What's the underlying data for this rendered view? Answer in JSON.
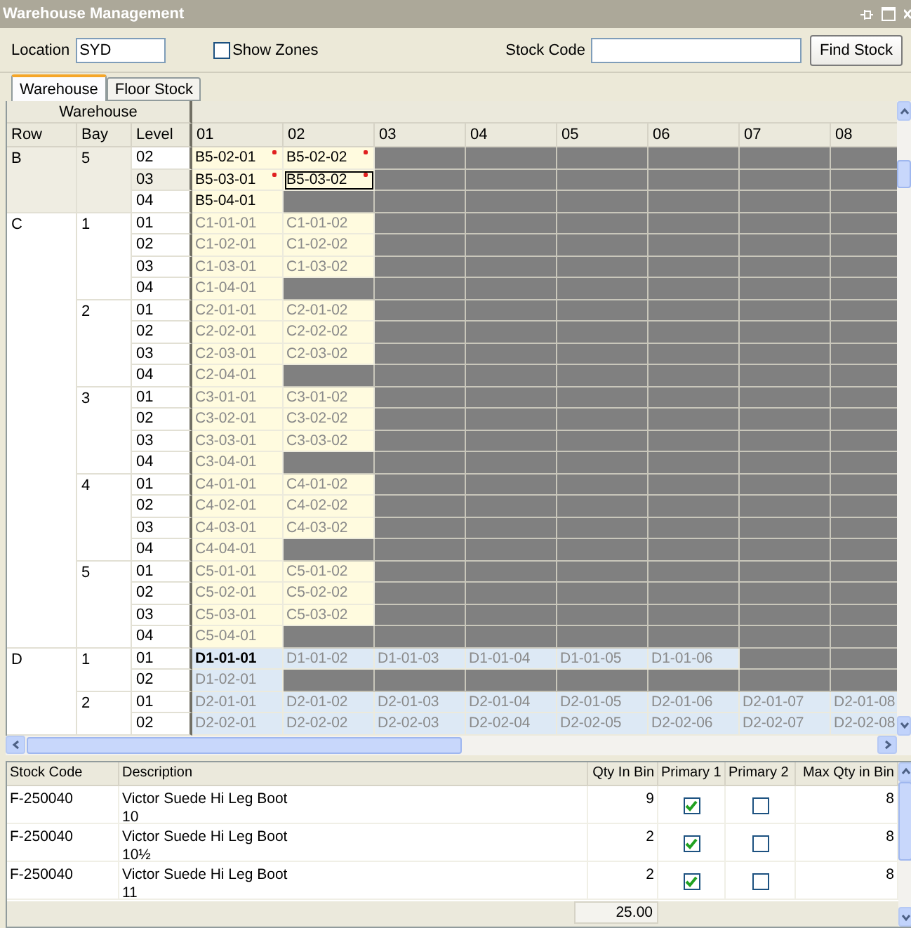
{
  "window": {
    "title": "Warehouse Management"
  },
  "toolbar": {
    "location_label": "Location",
    "location_value": "SYD",
    "show_zones": {
      "label": "Show Zones",
      "checked": false
    },
    "stock_code_label": "Stock Code",
    "find_button": "Find Stock"
  },
  "tabs": [
    {
      "label": "Warehouse",
      "selected": true
    },
    {
      "label": "Floor Stock",
      "selected": false
    }
  ],
  "grid": {
    "group_header": "Warehouse",
    "columns": [
      "Row",
      "Bay",
      "Level"
    ],
    "bin_columns": [
      "01",
      "02",
      "03",
      "04",
      "05",
      "06",
      "07",
      "08"
    ],
    "rows": [
      {
        "row": "B",
        "selected": true,
        "color": "#fffbdf",
        "bays": [
          {
            "bay": "5",
            "levels": [
              {
                "level": "02",
                "selected": false,
                "cells": [
                  {
                    "label": "B5-02-01",
                    "kind": "flagged"
                  },
                  {
                    "label": "B5-02-02",
                    "kind": "flagged"
                  },
                  {
                    "kind": "none"
                  },
                  {
                    "kind": "none"
                  },
                  {
                    "kind": "none"
                  },
                  {
                    "kind": "none"
                  },
                  {
                    "kind": "none"
                  },
                  {
                    "kind": "none"
                  }
                ]
              },
              {
                "level": "03",
                "selected": true,
                "cells": [
                  {
                    "label": "B5-03-01",
                    "kind": "flagged"
                  },
                  {
                    "label": "B5-03-02",
                    "kind": "focused"
                  },
                  {
                    "kind": "none"
                  },
                  {
                    "kind": "none"
                  },
                  {
                    "kind": "none"
                  },
                  {
                    "kind": "none"
                  },
                  {
                    "kind": "none"
                  },
                  {
                    "kind": "none"
                  }
                ]
              },
              {
                "level": "04",
                "selected": false,
                "cells": [
                  {
                    "label": "B5-04-01",
                    "kind": "stocked"
                  },
                  {
                    "kind": "none"
                  },
                  {
                    "kind": "none"
                  },
                  {
                    "kind": "none"
                  },
                  {
                    "kind": "none"
                  },
                  {
                    "kind": "none"
                  },
                  {
                    "kind": "none"
                  },
                  {
                    "kind": "none"
                  }
                ]
              }
            ]
          }
        ]
      },
      {
        "row": "C",
        "selected": false,
        "color": "#fffbdf",
        "bays": [
          {
            "bay": "1",
            "levels": [
              {
                "level": "01",
                "selected": false,
                "cells": [
                  {
                    "label": "C1-01-01",
                    "kind": "bin"
                  },
                  {
                    "label": "C1-01-02",
                    "kind": "bin"
                  },
                  {
                    "kind": "none"
                  },
                  {
                    "kind": "none"
                  },
                  {
                    "kind": "none"
                  },
                  {
                    "kind": "none"
                  },
                  {
                    "kind": "none"
                  },
                  {
                    "kind": "none"
                  }
                ]
              },
              {
                "level": "02",
                "selected": false,
                "cells": [
                  {
                    "label": "C1-02-01",
                    "kind": "bin"
                  },
                  {
                    "label": "C1-02-02",
                    "kind": "bin"
                  },
                  {
                    "kind": "none"
                  },
                  {
                    "kind": "none"
                  },
                  {
                    "kind": "none"
                  },
                  {
                    "kind": "none"
                  },
                  {
                    "kind": "none"
                  },
                  {
                    "kind": "none"
                  }
                ]
              },
              {
                "level": "03",
                "selected": false,
                "cells": [
                  {
                    "label": "C1-03-01",
                    "kind": "bin"
                  },
                  {
                    "label": "C1-03-02",
                    "kind": "bin"
                  },
                  {
                    "kind": "none"
                  },
                  {
                    "kind": "none"
                  },
                  {
                    "kind": "none"
                  },
                  {
                    "kind": "none"
                  },
                  {
                    "kind": "none"
                  },
                  {
                    "kind": "none"
                  }
                ]
              },
              {
                "level": "04",
                "selected": false,
                "cells": [
                  {
                    "label": "C1-04-01",
                    "kind": "bin"
                  },
                  {
                    "kind": "none"
                  },
                  {
                    "kind": "none"
                  },
                  {
                    "kind": "none"
                  },
                  {
                    "kind": "none"
                  },
                  {
                    "kind": "none"
                  },
                  {
                    "kind": "none"
                  },
                  {
                    "kind": "none"
                  }
                ]
              }
            ]
          },
          {
            "bay": "2",
            "levels": [
              {
                "level": "01",
                "selected": false,
                "cells": [
                  {
                    "label": "C2-01-01",
                    "kind": "bin"
                  },
                  {
                    "label": "C2-01-02",
                    "kind": "bin"
                  },
                  {
                    "kind": "none"
                  },
                  {
                    "kind": "none"
                  },
                  {
                    "kind": "none"
                  },
                  {
                    "kind": "none"
                  },
                  {
                    "kind": "none"
                  },
                  {
                    "kind": "none"
                  }
                ]
              },
              {
                "level": "02",
                "selected": false,
                "cells": [
                  {
                    "label": "C2-02-01",
                    "kind": "bin"
                  },
                  {
                    "label": "C2-02-02",
                    "kind": "bin"
                  },
                  {
                    "kind": "none"
                  },
                  {
                    "kind": "none"
                  },
                  {
                    "kind": "none"
                  },
                  {
                    "kind": "none"
                  },
                  {
                    "kind": "none"
                  },
                  {
                    "kind": "none"
                  }
                ]
              },
              {
                "level": "03",
                "selected": false,
                "cells": [
                  {
                    "label": "C2-03-01",
                    "kind": "bin"
                  },
                  {
                    "label": "C2-03-02",
                    "kind": "bin"
                  },
                  {
                    "kind": "none"
                  },
                  {
                    "kind": "none"
                  },
                  {
                    "kind": "none"
                  },
                  {
                    "kind": "none"
                  },
                  {
                    "kind": "none"
                  },
                  {
                    "kind": "none"
                  }
                ]
              },
              {
                "level": "04",
                "selected": false,
                "cells": [
                  {
                    "label": "C2-04-01",
                    "kind": "bin"
                  },
                  {
                    "kind": "none"
                  },
                  {
                    "kind": "none"
                  },
                  {
                    "kind": "none"
                  },
                  {
                    "kind": "none"
                  },
                  {
                    "kind": "none"
                  },
                  {
                    "kind": "none"
                  },
                  {
                    "kind": "none"
                  }
                ]
              }
            ]
          },
          {
            "bay": "3",
            "levels": [
              {
                "level": "01",
                "selected": false,
                "cells": [
                  {
                    "label": "C3-01-01",
                    "kind": "bin"
                  },
                  {
                    "label": "C3-01-02",
                    "kind": "bin"
                  },
                  {
                    "kind": "none"
                  },
                  {
                    "kind": "none"
                  },
                  {
                    "kind": "none"
                  },
                  {
                    "kind": "none"
                  },
                  {
                    "kind": "none"
                  },
                  {
                    "kind": "none"
                  }
                ]
              },
              {
                "level": "02",
                "selected": false,
                "cells": [
                  {
                    "label": "C3-02-01",
                    "kind": "bin"
                  },
                  {
                    "label": "C3-02-02",
                    "kind": "bin"
                  },
                  {
                    "kind": "none"
                  },
                  {
                    "kind": "none"
                  },
                  {
                    "kind": "none"
                  },
                  {
                    "kind": "none"
                  },
                  {
                    "kind": "none"
                  },
                  {
                    "kind": "none"
                  }
                ]
              },
              {
                "level": "03",
                "selected": false,
                "cells": [
                  {
                    "label": "C3-03-01",
                    "kind": "bin"
                  },
                  {
                    "label": "C3-03-02",
                    "kind": "bin"
                  },
                  {
                    "kind": "none"
                  },
                  {
                    "kind": "none"
                  },
                  {
                    "kind": "none"
                  },
                  {
                    "kind": "none"
                  },
                  {
                    "kind": "none"
                  },
                  {
                    "kind": "none"
                  }
                ]
              },
              {
                "level": "04",
                "selected": false,
                "cells": [
                  {
                    "label": "C3-04-01",
                    "kind": "bin"
                  },
                  {
                    "kind": "none"
                  },
                  {
                    "kind": "none"
                  },
                  {
                    "kind": "none"
                  },
                  {
                    "kind": "none"
                  },
                  {
                    "kind": "none"
                  },
                  {
                    "kind": "none"
                  },
                  {
                    "kind": "none"
                  }
                ]
              }
            ]
          },
          {
            "bay": "4",
            "levels": [
              {
                "level": "01",
                "selected": false,
                "cells": [
                  {
                    "label": "C4-01-01",
                    "kind": "bin"
                  },
                  {
                    "label": "C4-01-02",
                    "kind": "bin"
                  },
                  {
                    "kind": "none"
                  },
                  {
                    "kind": "none"
                  },
                  {
                    "kind": "none"
                  },
                  {
                    "kind": "none"
                  },
                  {
                    "kind": "none"
                  },
                  {
                    "kind": "none"
                  }
                ]
              },
              {
                "level": "02",
                "selected": false,
                "cells": [
                  {
                    "label": "C4-02-01",
                    "kind": "bin"
                  },
                  {
                    "label": "C4-02-02",
                    "kind": "bin"
                  },
                  {
                    "kind": "none"
                  },
                  {
                    "kind": "none"
                  },
                  {
                    "kind": "none"
                  },
                  {
                    "kind": "none"
                  },
                  {
                    "kind": "none"
                  },
                  {
                    "kind": "none"
                  }
                ]
              },
              {
                "level": "03",
                "selected": false,
                "cells": [
                  {
                    "label": "C4-03-01",
                    "kind": "bin"
                  },
                  {
                    "label": "C4-03-02",
                    "kind": "bin"
                  },
                  {
                    "kind": "none"
                  },
                  {
                    "kind": "none"
                  },
                  {
                    "kind": "none"
                  },
                  {
                    "kind": "none"
                  },
                  {
                    "kind": "none"
                  },
                  {
                    "kind": "none"
                  }
                ]
              },
              {
                "level": "04",
                "selected": false,
                "cells": [
                  {
                    "label": "C4-04-01",
                    "kind": "bin"
                  },
                  {
                    "kind": "none"
                  },
                  {
                    "kind": "none"
                  },
                  {
                    "kind": "none"
                  },
                  {
                    "kind": "none"
                  },
                  {
                    "kind": "none"
                  },
                  {
                    "kind": "none"
                  },
                  {
                    "kind": "none"
                  }
                ]
              }
            ]
          },
          {
            "bay": "5",
            "levels": [
              {
                "level": "01",
                "selected": false,
                "cells": [
                  {
                    "label": "C5-01-01",
                    "kind": "bin"
                  },
                  {
                    "label": "C5-01-02",
                    "kind": "bin"
                  },
                  {
                    "kind": "none"
                  },
                  {
                    "kind": "none"
                  },
                  {
                    "kind": "none"
                  },
                  {
                    "kind": "none"
                  },
                  {
                    "kind": "none"
                  },
                  {
                    "kind": "none"
                  }
                ]
              },
              {
                "level": "02",
                "selected": false,
                "cells": [
                  {
                    "label": "C5-02-01",
                    "kind": "bin"
                  },
                  {
                    "label": "C5-02-02",
                    "kind": "bin"
                  },
                  {
                    "kind": "none"
                  },
                  {
                    "kind": "none"
                  },
                  {
                    "kind": "none"
                  },
                  {
                    "kind": "none"
                  },
                  {
                    "kind": "none"
                  },
                  {
                    "kind": "none"
                  }
                ]
              },
              {
                "level": "03",
                "selected": false,
                "cells": [
                  {
                    "label": "C5-03-01",
                    "kind": "bin"
                  },
                  {
                    "label": "C5-03-02",
                    "kind": "bin"
                  },
                  {
                    "kind": "none"
                  },
                  {
                    "kind": "none"
                  },
                  {
                    "kind": "none"
                  },
                  {
                    "kind": "none"
                  },
                  {
                    "kind": "none"
                  },
                  {
                    "kind": "none"
                  }
                ]
              },
              {
                "level": "04",
                "selected": false,
                "cells": [
                  {
                    "label": "C5-04-01",
                    "kind": "bin"
                  },
                  {
                    "kind": "none"
                  },
                  {
                    "kind": "none"
                  },
                  {
                    "kind": "none"
                  },
                  {
                    "kind": "none"
                  },
                  {
                    "kind": "none"
                  },
                  {
                    "kind": "none"
                  },
                  {
                    "kind": "none"
                  }
                ]
              }
            ]
          }
        ]
      },
      {
        "row": "D",
        "selected": false,
        "color": "#dde9f5",
        "bays": [
          {
            "bay": "1",
            "levels": [
              {
                "level": "01",
                "selected": false,
                "cells": [
                  {
                    "label": "D1-01-01",
                    "kind": "current"
                  },
                  {
                    "label": "D1-01-02",
                    "kind": "bin"
                  },
                  {
                    "label": "D1-01-03",
                    "kind": "bin"
                  },
                  {
                    "label": "D1-01-04",
                    "kind": "bin"
                  },
                  {
                    "label": "D1-01-05",
                    "kind": "bin"
                  },
                  {
                    "label": "D1-01-06",
                    "kind": "bin"
                  },
                  {
                    "kind": "none"
                  },
                  {
                    "kind": "none"
                  }
                ]
              },
              {
                "level": "02",
                "selected": false,
                "cells": [
                  {
                    "label": "D1-02-01",
                    "kind": "bin"
                  },
                  {
                    "kind": "none"
                  },
                  {
                    "kind": "none"
                  },
                  {
                    "kind": "none"
                  },
                  {
                    "kind": "none"
                  },
                  {
                    "kind": "none"
                  },
                  {
                    "kind": "none"
                  },
                  {
                    "kind": "none"
                  }
                ]
              }
            ]
          },
          {
            "bay": "2",
            "levels": [
              {
                "level": "01",
                "selected": false,
                "cells": [
                  {
                    "label": "D2-01-01",
                    "kind": "bin"
                  },
                  {
                    "label": "D2-01-02",
                    "kind": "bin"
                  },
                  {
                    "label": "D2-01-03",
                    "kind": "bin"
                  },
                  {
                    "label": "D2-01-04",
                    "kind": "bin"
                  },
                  {
                    "label": "D2-01-05",
                    "kind": "bin"
                  },
                  {
                    "label": "D2-01-06",
                    "kind": "bin"
                  },
                  {
                    "label": "D2-01-07",
                    "kind": "bin"
                  },
                  {
                    "label": "D2-01-08",
                    "kind": "bin"
                  }
                ]
              },
              {
                "level": "02",
                "selected": false,
                "cells": [
                  {
                    "label": "D2-02-01",
                    "kind": "bin"
                  },
                  {
                    "label": "D2-02-02",
                    "kind": "bin"
                  },
                  {
                    "label": "D2-02-03",
                    "kind": "bin"
                  },
                  {
                    "label": "D2-02-04",
                    "kind": "bin"
                  },
                  {
                    "label": "D2-02-05",
                    "kind": "bin"
                  },
                  {
                    "label": "D2-02-06",
                    "kind": "bin"
                  },
                  {
                    "label": "D2-02-07",
                    "kind": "bin"
                  },
                  {
                    "label": "D2-02-08",
                    "kind": "bin"
                  }
                ]
              }
            ]
          }
        ]
      }
    ]
  },
  "stock_table": {
    "columns": [
      "Stock Code",
      "Description",
      "Qty In Bin",
      "Primary 1",
      "Primary 2",
      "Max Qty in Bin"
    ],
    "rows": [
      {
        "stock_code": "F-250040",
        "description": "Victor Suede Hi Leg Boot\n10",
        "qty_in_bin": "9",
        "primary_1": true,
        "primary_2": false,
        "max_qty": "8"
      },
      {
        "stock_code": "F-250040",
        "description": "Victor Suede Hi Leg Boot\n10½",
        "qty_in_bin": "2",
        "primary_1": true,
        "primary_2": false,
        "max_qty": "8"
      },
      {
        "stock_code": "F-250040",
        "description": "Victor Suede Hi Leg Boot\n11",
        "qty_in_bin": "2",
        "primary_1": true,
        "primary_2": false,
        "max_qty": "8"
      }
    ],
    "total_qty": "25.00"
  }
}
